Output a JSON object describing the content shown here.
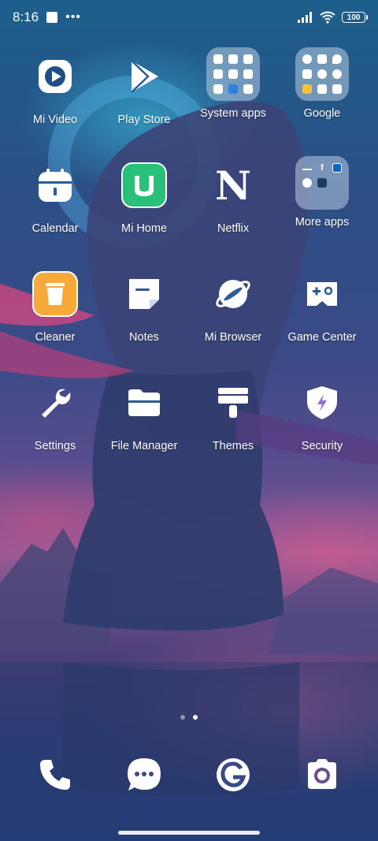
{
  "status_bar": {
    "time": "8:16",
    "overflow_dots": "•••",
    "battery": "100"
  },
  "apps": {
    "row1": [
      "Mi Video",
      "Play Store",
      "System apps",
      "Google"
    ],
    "row2": [
      "Calendar",
      "Mi Home",
      "Netflix",
      "More apps"
    ],
    "row3": [
      "Cleaner",
      "Notes",
      "Mi Browser",
      "Game Center"
    ],
    "row4": [
      "Settings",
      "File Manager",
      "Themes",
      "Security"
    ]
  },
  "netflix_logo_letter": "N",
  "dock": {
    "items": [
      "phone-icon",
      "messages-icon",
      "browser-g-icon",
      "camera-icon"
    ]
  },
  "page_indicator": {
    "pages": 2,
    "active_page": 2
  },
  "colors": {
    "cleaner_accent": "#f7a93a",
    "mi_home_accent": "#29c07a",
    "security_accent": "#9a6ad8"
  }
}
